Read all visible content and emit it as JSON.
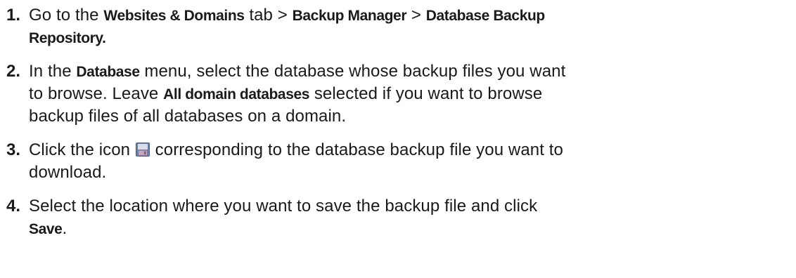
{
  "steps": [
    {
      "number": "1.",
      "parts": {
        "p1": "Go to the ",
        "b1": "Websites & Domains",
        "p2": " tab > ",
        "b2": "Backup Manager",
        "p3": " > ",
        "b3": "Database Backup",
        "b4": "Repository."
      }
    },
    {
      "number": "2.",
      "parts": {
        "p1": "In the ",
        "b1": "Database",
        "p2": " menu, select the database whose backup files you want",
        "p3": "to browse. Leave ",
        "b2": "All domain databases",
        "p4": " selected if you want to browse",
        "p5": "backup files of all databases on a domain."
      }
    },
    {
      "number": "3.",
      "parts": {
        "p1": "Click the icon ",
        "icon": "save-icon",
        "p2": " corresponding to the database backup file you want to",
        "p3": "download."
      }
    },
    {
      "number": "4.",
      "parts": {
        "p1": "Select the location where you want to save the backup file and click",
        "b1": "Save",
        "p2": "."
      }
    }
  ],
  "colors": {
    "text": "#1a1a1a",
    "icon_body": "#6b7fa6",
    "icon_label": "#d2b4c9"
  }
}
